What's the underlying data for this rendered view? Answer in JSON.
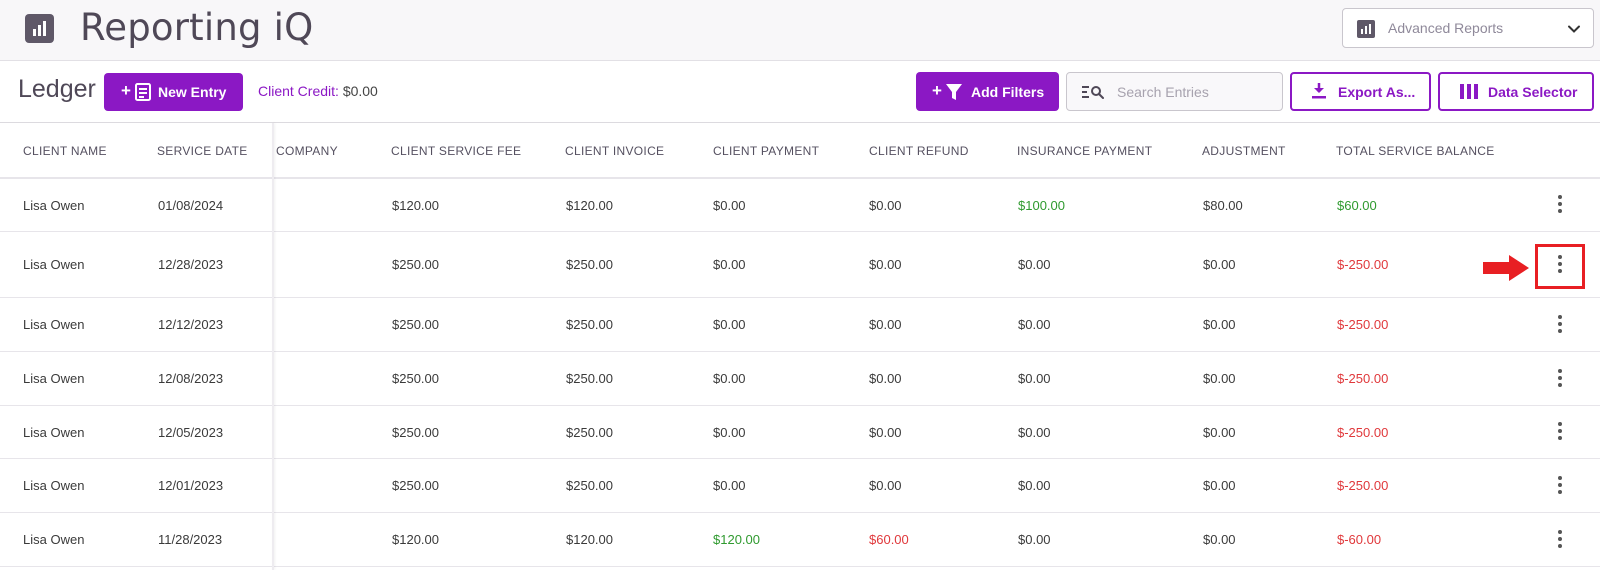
{
  "app": {
    "title": "Reporting iQ",
    "report_selector": {
      "value": "Advanced Reports"
    }
  },
  "toolbar": {
    "title": "Ledger",
    "new_entry_label": "New Entry",
    "client_credit_label": "Client Credit:",
    "client_credit_value": "$0.00",
    "add_filters_label": "Add Filters",
    "search_placeholder": "Search Entries",
    "export_label": "Export As...",
    "data_selector_label": "Data Selector"
  },
  "colors": {
    "accent": "#8b18c4",
    "positive": "#2f9a2f",
    "negative": "#e0383b",
    "annotation": "#e81f23"
  },
  "table": {
    "columns": [
      "CLIENT NAME",
      "SERVICE DATE",
      "COMPANY",
      "CLIENT SERVICE FEE",
      "CLIENT INVOICE",
      "CLIENT PAYMENT",
      "CLIENT REFUND",
      "INSURANCE PAYMENT",
      "ADJUSTMENT",
      "TOTAL SERVICE BALANCE"
    ],
    "rows": [
      {
        "client_name": "Lisa Owen",
        "service_date": "01/08/2024",
        "company": "",
        "client_service_fee": "$120.00",
        "client_invoice": "$120.00",
        "client_payment": "$0.00",
        "client_refund": "$0.00",
        "insurance_payment": "$100.00",
        "adjustment": "$80.00",
        "total_service_balance": "$60.00"
      },
      {
        "client_name": "Lisa Owen",
        "service_date": "12/28/2023",
        "company": "",
        "client_service_fee": "$250.00",
        "client_invoice": "$250.00",
        "client_payment": "$0.00",
        "client_refund": "$0.00",
        "insurance_payment": "$0.00",
        "adjustment": "$0.00",
        "total_service_balance": "$-250.00"
      },
      {
        "client_name": "Lisa Owen",
        "service_date": "12/12/2023",
        "company": "",
        "client_service_fee": "$250.00",
        "client_invoice": "$250.00",
        "client_payment": "$0.00",
        "client_refund": "$0.00",
        "insurance_payment": "$0.00",
        "adjustment": "$0.00",
        "total_service_balance": "$-250.00"
      },
      {
        "client_name": "Lisa Owen",
        "service_date": "12/08/2023",
        "company": "",
        "client_service_fee": "$250.00",
        "client_invoice": "$250.00",
        "client_payment": "$0.00",
        "client_refund": "$0.00",
        "insurance_payment": "$0.00",
        "adjustment": "$0.00",
        "total_service_balance": "$-250.00"
      },
      {
        "client_name": "Lisa Owen",
        "service_date": "12/05/2023",
        "company": "",
        "client_service_fee": "$250.00",
        "client_invoice": "$250.00",
        "client_payment": "$0.00",
        "client_refund": "$0.00",
        "insurance_payment": "$0.00",
        "adjustment": "$0.00",
        "total_service_balance": "$-250.00"
      },
      {
        "client_name": "Lisa Owen",
        "service_date": "12/01/2023",
        "company": "",
        "client_service_fee": "$250.00",
        "client_invoice": "$250.00",
        "client_payment": "$0.00",
        "client_refund": "$0.00",
        "insurance_payment": "$0.00",
        "adjustment": "$0.00",
        "total_service_balance": "$-250.00"
      },
      {
        "client_name": "Lisa Owen",
        "service_date": "11/28/2023",
        "company": "",
        "client_service_fee": "$120.00",
        "client_invoice": "$120.00",
        "client_payment": "$120.00",
        "client_refund": "$60.00",
        "insurance_payment": "$0.00",
        "adjustment": "$0.00",
        "total_service_balance": "$-60.00"
      }
    ],
    "row_actions_icon": "more-vertical-icon",
    "highlighted_row_index": 1
  }
}
